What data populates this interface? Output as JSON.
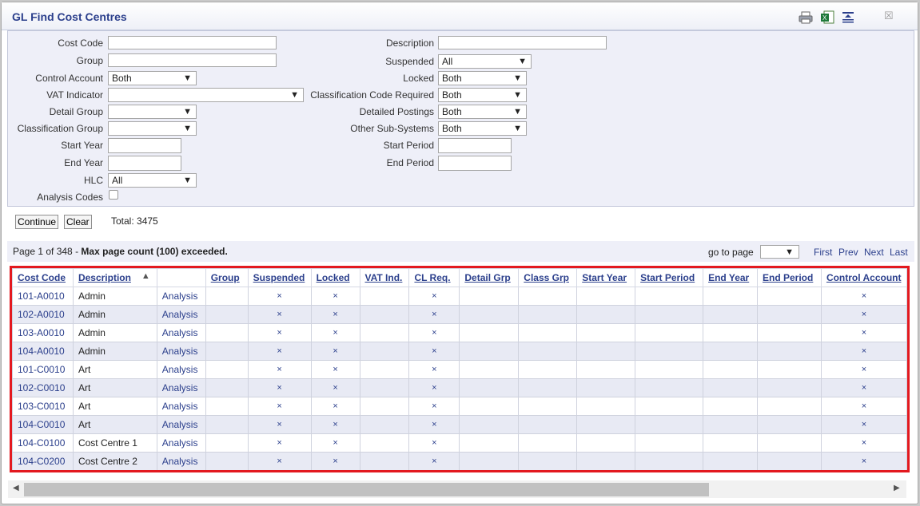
{
  "window": {
    "title": "GL Find Cost Centres",
    "close_glyph": "☒"
  },
  "filters": {
    "cost_code": {
      "label": "Cost Code",
      "value": ""
    },
    "group": {
      "label": "Group",
      "value": ""
    },
    "control_account": {
      "label": "Control Account",
      "value": "Both"
    },
    "vat_indicator": {
      "label": "VAT Indicator",
      "value": ""
    },
    "detail_group": {
      "label": "Detail Group",
      "value": ""
    },
    "classification_group": {
      "label": "Classification Group",
      "value": ""
    },
    "start_year": {
      "label": "Start Year",
      "value": ""
    },
    "end_year": {
      "label": "End Year",
      "value": ""
    },
    "hlc": {
      "label": "HLC",
      "value": "All"
    },
    "analysis_codes": {
      "label": "Analysis Codes",
      "checked": false
    },
    "description": {
      "label": "Description",
      "value": ""
    },
    "suspended": {
      "label": "Suspended",
      "value": "All"
    },
    "locked": {
      "label": "Locked",
      "value": "Both"
    },
    "classification_code_required": {
      "label": "Classification Code Required",
      "value": "Both"
    },
    "detailed_postings": {
      "label": "Detailed Postings",
      "value": "Both"
    },
    "other_sub_systems": {
      "label": "Other Sub-Systems",
      "value": "Both"
    },
    "start_period": {
      "label": "Start Period",
      "value": ""
    },
    "end_period": {
      "label": "End Period",
      "value": ""
    }
  },
  "actions": {
    "continue_label": "Continue",
    "clear_label": "Clear",
    "total": "Total: 3475"
  },
  "pager": {
    "page_info": "Page 1 of 348 - ",
    "page_warning": "Max page count (100) exceeded.",
    "goto_label": "go to page",
    "goto_value": "",
    "first": "First",
    "prev": "Prev",
    "next": "Next",
    "last": "Last"
  },
  "table": {
    "columns": [
      "Cost Code",
      "Description",
      "",
      "Group",
      "Suspended",
      "Locked",
      "VAT Ind.",
      "CL Req.",
      "Detail Grp",
      "Class Grp",
      "Start Year",
      "Start Period",
      "End Year",
      "End Period",
      "Control Account"
    ],
    "sort_indicator": "▲",
    "mark_glyph": "×",
    "rows": [
      {
        "code": "101-A0010",
        "desc": "Admin",
        "analysis": "Analysis"
      },
      {
        "code": "102-A0010",
        "desc": "Admin",
        "analysis": "Analysis"
      },
      {
        "code": "103-A0010",
        "desc": "Admin",
        "analysis": "Analysis"
      },
      {
        "code": "104-A0010",
        "desc": "Admin",
        "analysis": "Analysis"
      },
      {
        "code": "101-C0010",
        "desc": "Art",
        "analysis": "Analysis"
      },
      {
        "code": "102-C0010",
        "desc": "Art",
        "analysis": "Analysis"
      },
      {
        "code": "103-C0010",
        "desc": "Art",
        "analysis": "Analysis"
      },
      {
        "code": "104-C0010",
        "desc": "Art",
        "analysis": "Analysis"
      },
      {
        "code": "104-C0100",
        "desc": "Cost Centre 1",
        "analysis": "Analysis"
      },
      {
        "code": "104-C0200",
        "desc": "Cost Centre 2",
        "analysis": "Analysis"
      }
    ]
  }
}
